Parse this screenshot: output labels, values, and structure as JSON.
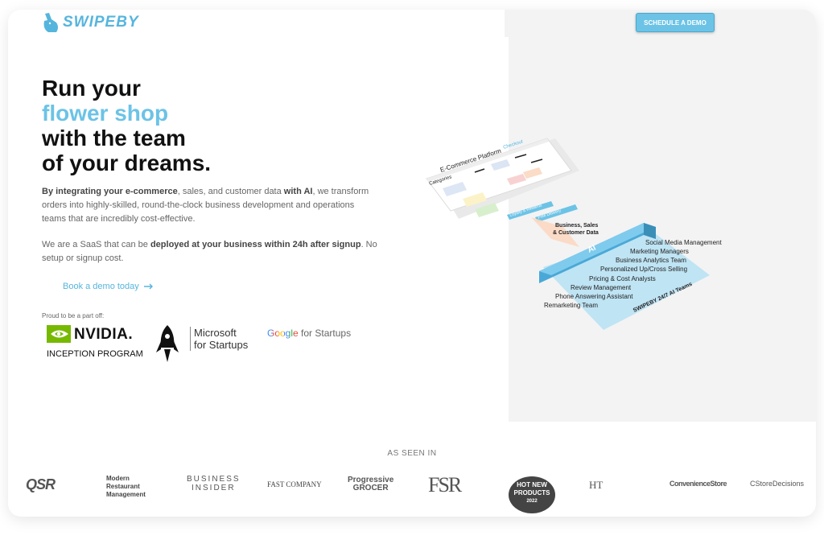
{
  "brand": {
    "name": "SWIPEBY",
    "color": "#56b5dd"
  },
  "header": {
    "cta_label": "SCHEDULE A DEMO"
  },
  "hero": {
    "line1": "Run your",
    "accent": "flower shop",
    "line3": "with the team",
    "line4": "of your dreams.",
    "p1": [
      {
        "text": "By integrating your e-commerce",
        "bold": true
      },
      {
        "text": ", sales, and customer data ",
        "bold": false
      },
      {
        "text": "with AI",
        "bold": true
      },
      {
        "text": ", we transform orders into highly-skilled, round-the-clock business development and operations teams that are incredibly cost-effective.",
        "bold": false
      }
    ],
    "p2": [
      {
        "text": "We are a SaaS  that can be ",
        "bold": false
      },
      {
        "text": "deployed at your business within 24h after signup",
        "bold": true
      },
      {
        "text": ". No setup or signup cost.",
        "bold": false
      }
    ],
    "book_link": "Book a demo today",
    "proud": "Proud to be a part off:"
  },
  "partners": {
    "nvidia": "NVIDIA.",
    "nvidia_sub": "INCEPTION PROGRAM",
    "microsoft_line1": "Microsoft",
    "microsoft_line2": "for Startups",
    "google_word": "Google",
    "google_rest": " for Startups"
  },
  "diagram": {
    "platform_title": "E-Commerce Platform",
    "checkout": "Checkout",
    "categories": "Categories",
    "loyalty": "Loyalty & Rewards",
    "delivery": "Free Delivery",
    "data_label_1": "Business, Sales",
    "data_label_2": "& Customer Data",
    "ai": "AI",
    "team_label": "SWIPEBY 24/7 AI Teams",
    "teams": [
      "Social Media Management",
      "Marketing Managers",
      "Business Analytics Team",
      "Personalized Up/Cross Selling",
      "Pricing & Cost Analysts",
      "Review Management",
      "Phone Answering Assistant",
      "Remarketing Team"
    ]
  },
  "press": {
    "heading": "AS SEEN IN",
    "qsr": "QSR",
    "mrm": [
      "Modern",
      "Restaurant",
      "Management"
    ],
    "bi": [
      "BUSINESS",
      "INSIDER"
    ],
    "fc": "FAST COMPANY",
    "pg": [
      "Progressive",
      "GROCER"
    ],
    "fsr": "FSR",
    "hotnew": [
      "HOT NEW",
      "PRODUCTS",
      "2022"
    ],
    "ht": "HT",
    "cs": "ConvenienceStore",
    "csd": "CStoreDecisions"
  }
}
